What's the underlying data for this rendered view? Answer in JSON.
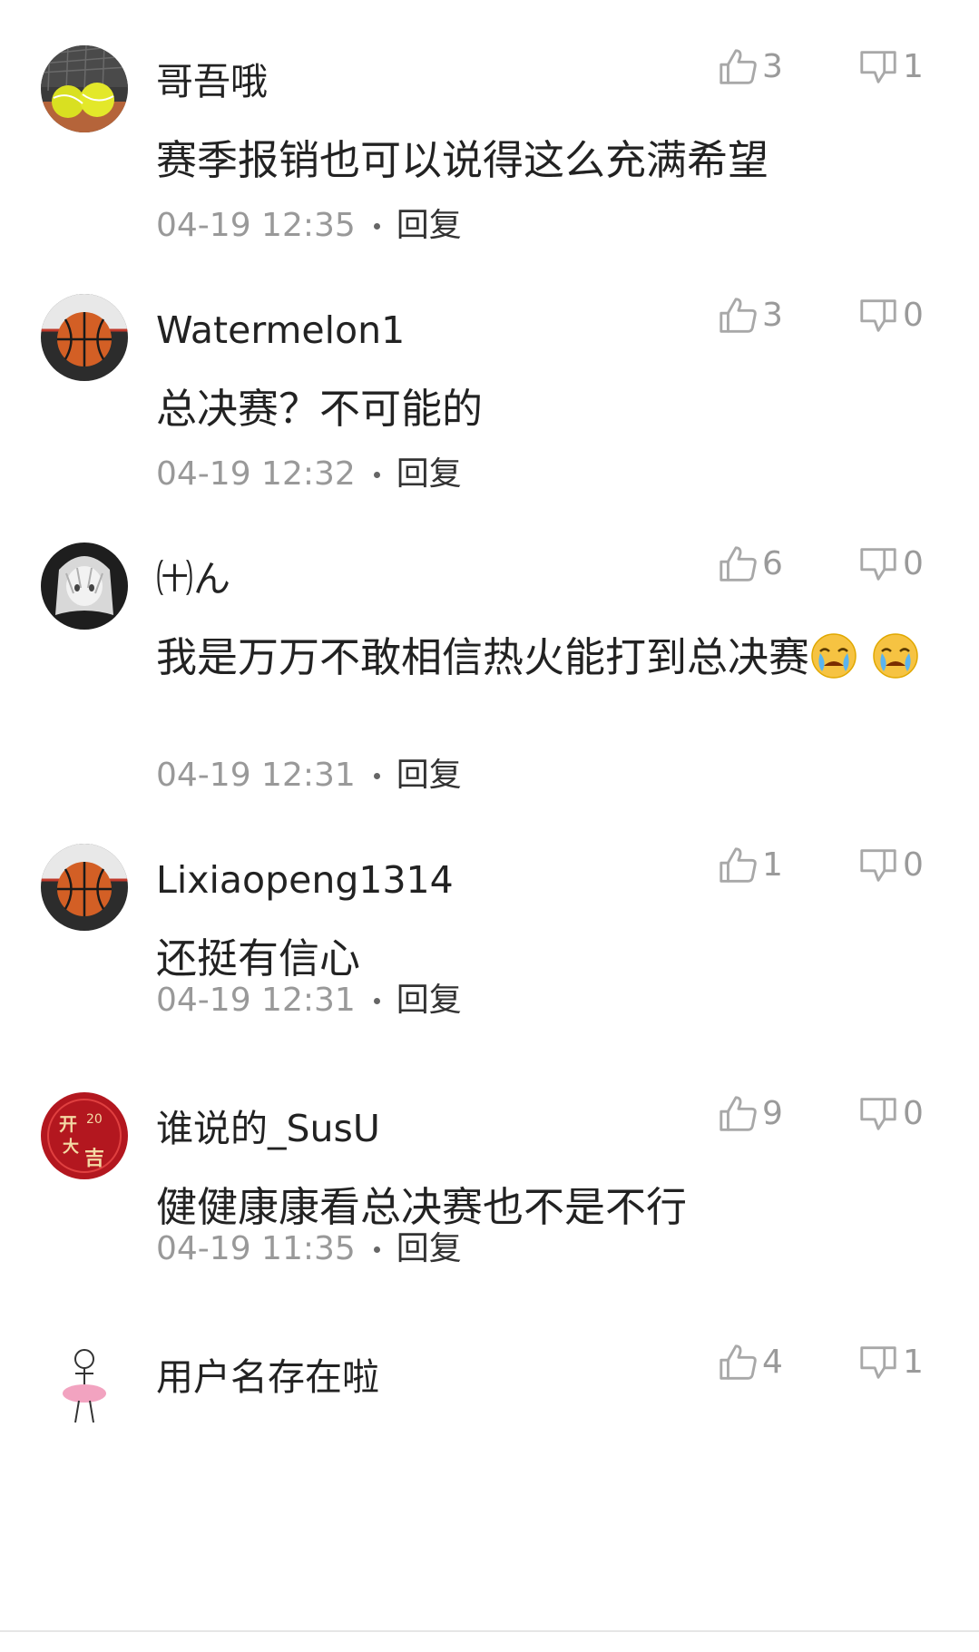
{
  "comments": [
    {
      "username": "哥吾哦",
      "avatar": "tennis-balls-avatar",
      "likes": "3",
      "dislikes": "1",
      "content": "赛季报销也可以说得这么充满希望",
      "time": "04-19 12:35",
      "reply_label": "回复"
    },
    {
      "username": "Watermelon1",
      "avatar": "basketball-avatar",
      "likes": "3",
      "dislikes": "0",
      "content": "总决赛？不可能的",
      "time": "04-19 12:32",
      "reply_label": "回复"
    },
    {
      "username": "㈩ん",
      "avatar": "anime-girl-avatar",
      "likes": "6",
      "dislikes": "0",
      "content": "我是万万不敢相信热火能打到总决赛",
      "emoji": "crying-face-emoji",
      "time": "04-19 12:31",
      "reply_label": "回复"
    },
    {
      "username": "Lixiaopeng1314",
      "avatar": "basketball-avatar",
      "likes": "1",
      "dislikes": "0",
      "content": "还挺有信心",
      "time": "04-19 12:31",
      "reply_label": "回复"
    },
    {
      "username": "谁说的_SusU",
      "avatar": "kai-men-da-ji-avatar",
      "avatar_text": "开门大吉 20",
      "likes": "9",
      "dislikes": "0",
      "content": "健健康康看总决赛也不是不行",
      "time": "04-19 11:35",
      "reply_label": "回复"
    },
    {
      "username": "用户名存在啦",
      "avatar": "dancer-avatar",
      "likes": "4",
      "dislikes": "1"
    }
  ],
  "colors": {
    "text_primary": "#222222",
    "text_secondary": "#999999",
    "icon_gray": "#a8a8a8"
  }
}
